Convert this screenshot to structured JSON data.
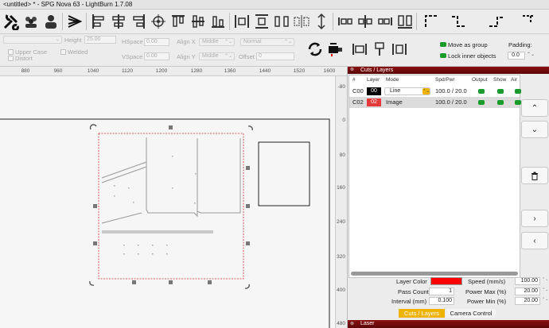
{
  "window": {
    "title": "<untitled> * - SPG Nova 63 - LightBurn 1.7.08"
  },
  "toolbar": {
    "icons": [
      "wrench-icon",
      "users-icon",
      "user-icon",
      "text-tool-icon",
      "align-left-icon",
      "align-center-h-icon",
      "align-right-icon",
      "align-top-icon",
      "align-center-v-icon",
      "align-bottom-icon",
      "target-icon",
      "distribute-icon",
      "distribute-v-icon",
      "corner-icon",
      "step-icon",
      "corner-dash-icon"
    ]
  },
  "options": {
    "height_label": "Height",
    "height_value": "25.00",
    "hspace_label": "HSpace",
    "hspace_value": "0.00",
    "vspace_label": "VSpace",
    "vspace_value": "0.00",
    "align_x_label": "Align X",
    "align_x_value": "Middle",
    "align_y_label": "Align Y",
    "align_y_value": "Middle",
    "font_style_value": "Normal",
    "offset_label": "Offset",
    "offset_value": "0",
    "upper_case_label": "Upper Case",
    "welded_label": "Welded",
    "distort_label": "Distort",
    "move_as_group_label": "Move as group",
    "lock_inner_label": "Lock inner objects",
    "padding_label": "Padding:",
    "padding_value": "0.0"
  },
  "ruler": {
    "top": [
      "880",
      "960",
      "1040",
      "1120",
      "1200",
      "1280",
      "1360",
      "1440",
      "1520",
      "1600"
    ],
    "right": [
      "-80",
      "0",
      "80",
      "160",
      "240",
      "320",
      "400",
      "480"
    ]
  },
  "cuts_panel": {
    "title": "Cuts / Layers",
    "headers": {
      "num": "#",
      "layer": "Layer",
      "mode": "Mode",
      "spd": "Spd/Pwr",
      "output": "Output",
      "show": "Show",
      "air": "Air"
    },
    "rows": [
      {
        "id": "C00",
        "layer": "00",
        "color": "#000000",
        "mode": "Line",
        "spd": "100.0 / 20.0"
      },
      {
        "id": "C02",
        "layer": "02",
        "color": "#e63a3a",
        "mode": "Image",
        "spd": "100.0 / 20.0"
      }
    ],
    "layer_color_label": "Layer Color",
    "layer_color": "#ff0000",
    "pass_count_label": "Pass Count",
    "pass_count": "1",
    "interval_label": "Interval (mm)",
    "interval": "0.100",
    "speed_label": "Speed (mm/s)",
    "speed": "100.00",
    "power_max_label": "Power Max (%)",
    "power_max": "20.00",
    "power_min_label": "Power Min (%)",
    "power_min": "20.00",
    "tab_cuts": "Cuts / Layers",
    "tab_camera": "Camera Control"
  },
  "laser_panel": {
    "title": "Laser"
  }
}
